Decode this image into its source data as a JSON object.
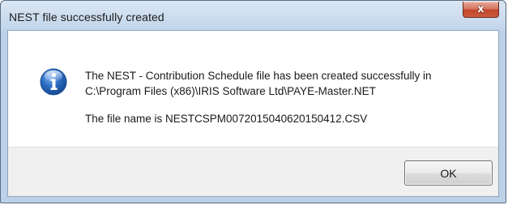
{
  "window": {
    "title": "NEST file successfully created",
    "close_icon": "close-icon",
    "close_glyph": "x"
  },
  "message": {
    "icon": "information-icon",
    "line1": "The NEST - Contribution Schedule file has been created successfully in",
    "line2": "C:\\Program Files (x86)\\IRIS Software Ltd\\PAYE-Master.NET",
    "line3": "The file name is NESTCSPM0072015040620150412.CSV"
  },
  "buttons": {
    "ok_label": "OK"
  },
  "colors": {
    "frame": "#c6d8ec",
    "close_button": "#c2452a",
    "info_icon": "#2a6bc0",
    "footer": "#f0f0f0"
  }
}
